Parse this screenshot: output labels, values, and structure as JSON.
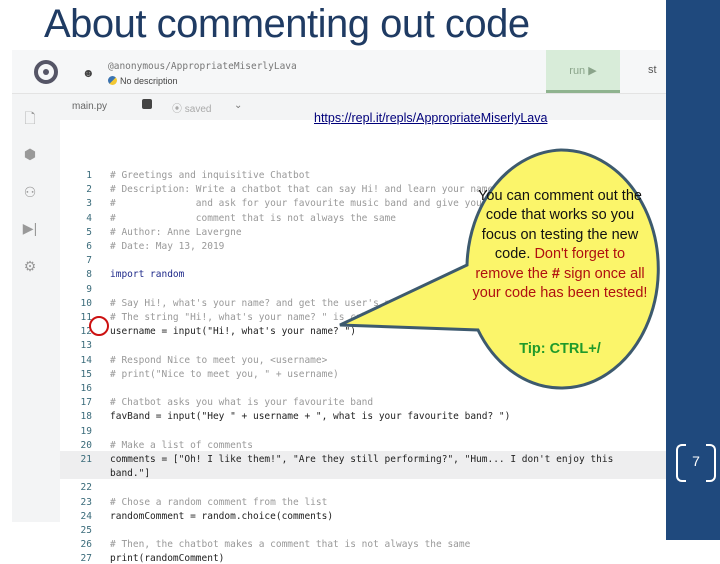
{
  "slide": {
    "title": "About commenting out code",
    "page_number": "7",
    "link": "https://repl.it/repls/AppropriateMiserlyLava"
  },
  "repl": {
    "repl_name": "@anonymous/AppropriateMiserlyLava",
    "description": "No description",
    "run_label": "run ▶",
    "stop_label": "st",
    "tab": "main.py",
    "saved": "saved",
    "sidebar_icons": [
      "file-icon",
      "package-icon",
      "multiplayer-icon",
      "debugger-icon",
      "settings-icon"
    ]
  },
  "code_lines": [
    {
      "n": "1",
      "t": "# Greetings and inquisitive Chatbot",
      "c": "cm"
    },
    {
      "n": "2",
      "t": "# Description: Write a chatbot that can say Hi! and learn your name",
      "c": "cm"
    },
    {
      "n": "3",
      "t": "#              and ask for your favourite music band and give you a",
      "c": "cm"
    },
    {
      "n": "4",
      "t": "#              comment that is not always the same",
      "c": "cm"
    },
    {
      "n": "5",
      "t": "# Author: Anne Lavergne",
      "c": "cm"
    },
    {
      "n": "6",
      "t": "# Date: May 13, 2019",
      "c": "cm"
    },
    {
      "n": "7",
      "t": "",
      "c": ""
    },
    {
      "n": "8",
      "t": "import random",
      "c": "kw"
    },
    {
      "n": "9",
      "t": "",
      "c": ""
    },
    {
      "n": "10",
      "t": "# Say Hi!, what's your name? and get the user's name",
      "c": "cm"
    },
    {
      "n": "11",
      "t": "# The string \"Hi!, what's your name? \" is called a prompt",
      "c": "cm"
    },
    {
      "n": "12",
      "t": "username = input(\"Hi!, what's your name? \")",
      "c": ""
    },
    {
      "n": "13",
      "t": "",
      "c": ""
    },
    {
      "n": "14",
      "t": "# Respond Nice to meet you, <username>",
      "c": "cm"
    },
    {
      "n": "15",
      "t": "# print(\"Nice to meet you, \" + username)",
      "c": "cm"
    },
    {
      "n": "16",
      "t": "",
      "c": ""
    },
    {
      "n": "17",
      "t": "# Chatbot asks you what is your favourite band",
      "c": "cm"
    },
    {
      "n": "18",
      "t": "favBand = input(\"Hey \" + username + \", what is your favourite band? \")",
      "c": ""
    },
    {
      "n": "19",
      "t": "",
      "c": ""
    },
    {
      "n": "20",
      "t": "# Make a list of comments",
      "c": "cm"
    },
    {
      "n": "21",
      "t": "comments = [\"Oh! I like them!\", \"Are they still performing?\", \"Hum... I don't enjoy this",
      "c": ""
    },
    {
      "n": "",
      "t": "band.\"]",
      "c": ""
    },
    {
      "n": "22",
      "t": "",
      "c": ""
    },
    {
      "n": "23",
      "t": "# Chose a random comment from the list",
      "c": "cm"
    },
    {
      "n": "24",
      "t": "randomComment = random.choice(comments)",
      "c": ""
    },
    {
      "n": "25",
      "t": "",
      "c": ""
    },
    {
      "n": "26",
      "t": "# Then, the chatbot makes a comment that is not always the same",
      "c": "cm"
    },
    {
      "n": "27",
      "t": "print(randomComment)",
      "c": ""
    }
  ],
  "callout": {
    "line1": "You can comment out the code that works so you focus on testing the new code.",
    "line2a": "Don't forget to remove the ",
    "hash": "#",
    "line2b": " sign once all your code has been tested!",
    "tip": "Tip: CTRL+/",
    "fill": "#fbf56a",
    "border": "#3d5a6e"
  },
  "colors": {
    "navy": "#1f497d",
    "title": "#1f3b63"
  }
}
